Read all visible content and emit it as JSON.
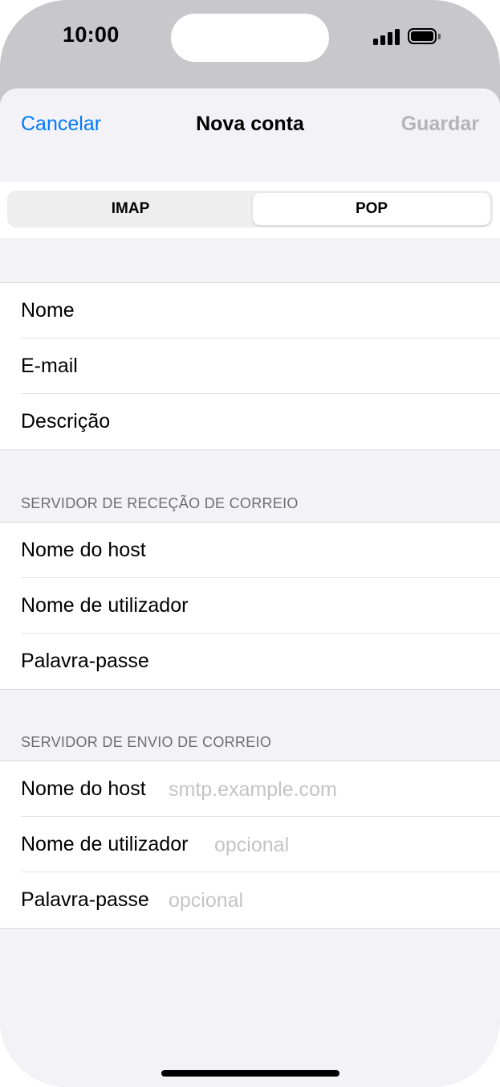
{
  "status_bar": {
    "time": "10:00",
    "signal_icon": "cellular-signal-icon",
    "battery_icon": "battery-icon"
  },
  "nav": {
    "cancel_label": "Cancelar",
    "title": "Nova conta",
    "save_label": "Guardar"
  },
  "segmented": {
    "options": [
      "IMAP",
      "POP"
    ],
    "selected": "POP"
  },
  "account": {
    "rows": [
      {
        "label": "Nome",
        "value": "",
        "placeholder": ""
      },
      {
        "label": "E-mail",
        "value": "",
        "placeholder": ""
      },
      {
        "label": "Descrição",
        "value": "",
        "placeholder": ""
      }
    ]
  },
  "incoming": {
    "header": "SERVIDOR DE RECEÇÃO DE CORREIO",
    "rows": [
      {
        "label": "Nome do host",
        "value": "",
        "placeholder": ""
      },
      {
        "label": "Nome de utilizador",
        "value": "",
        "placeholder": ""
      },
      {
        "label": "Palavra-passe",
        "value": "",
        "placeholder": ""
      }
    ]
  },
  "outgoing": {
    "header": "SERVIDOR DE ENVIO DE CORREIO",
    "rows": [
      {
        "label": "Nome do host",
        "value": "",
        "placeholder": "smtp.example.com"
      },
      {
        "label": "Nome de utilizador",
        "value": "",
        "placeholder": "opcional"
      },
      {
        "label": "Palavra-passe",
        "value": "",
        "placeholder": "opcional"
      }
    ]
  },
  "colors": {
    "accent": "#007aff",
    "disabled": "#b4b4b9",
    "placeholder": "#c4c4c6",
    "grouped_bg": "#f2f2f7"
  }
}
